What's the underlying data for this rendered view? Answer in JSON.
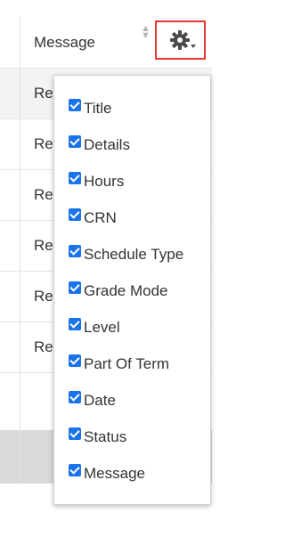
{
  "table": {
    "header_label": "Message",
    "rows": [
      "Re",
      "Re",
      "Re",
      "Re",
      "Re",
      "Re"
    ]
  },
  "column_menu": {
    "options": [
      {
        "label": "Title",
        "checked": true
      },
      {
        "label": "Details",
        "checked": true
      },
      {
        "label": "Hours",
        "checked": true
      },
      {
        "label": "CRN",
        "checked": true
      },
      {
        "label": "Schedule Type",
        "checked": true
      },
      {
        "label": "Grade Mode",
        "checked": true
      },
      {
        "label": "Level",
        "checked": true
      },
      {
        "label": "Part Of Term",
        "checked": true
      },
      {
        "label": "Date",
        "checked": true
      },
      {
        "label": "Status",
        "checked": true
      },
      {
        "label": "Message",
        "checked": true
      }
    ]
  },
  "colors": {
    "highlight_border": "#e53935",
    "checkbox": "#1a73e8",
    "row_shade": "#f3f3f3",
    "footer": "#d9d9d9"
  },
  "icons": {
    "settings": "gear-icon",
    "sort": "sort-arrows-icon"
  }
}
